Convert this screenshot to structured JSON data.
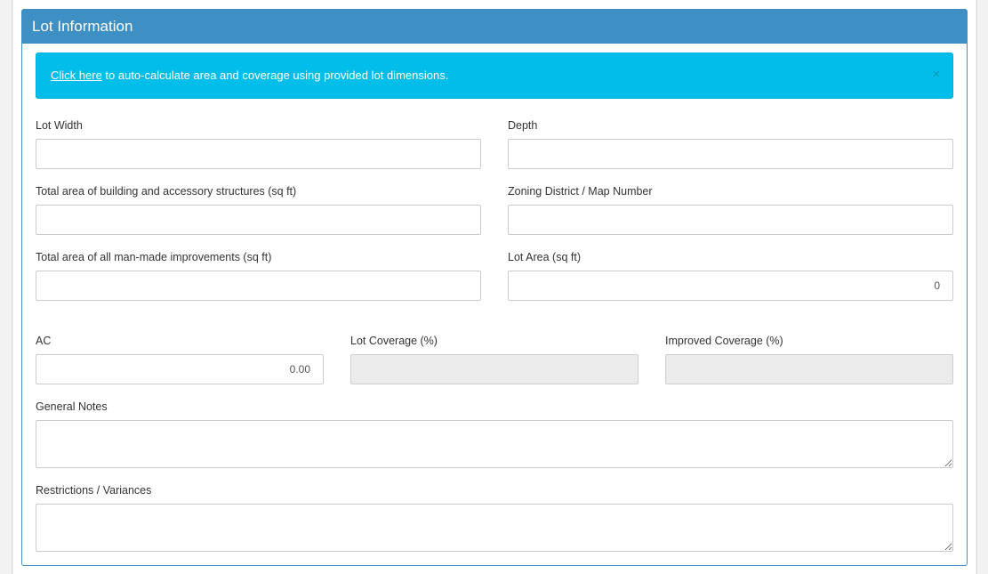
{
  "panel": {
    "title": "Lot Information"
  },
  "alert": {
    "link_text": "Click here",
    "message": " to auto-calculate area and coverage using provided lot dimensions.",
    "close_glyph": "×"
  },
  "fields": {
    "lot_width": {
      "label": "Lot Width",
      "value": ""
    },
    "depth": {
      "label": "Depth",
      "value": ""
    },
    "total_building_area": {
      "label": "Total area of building and accessory structures (sq ft)",
      "value": ""
    },
    "zoning_district": {
      "label": "Zoning District / Map Number",
      "value": ""
    },
    "total_improvements_area": {
      "label": "Total area of all man-made improvements (sq ft)",
      "value": ""
    },
    "lot_area": {
      "label": "Lot Area (sq ft)",
      "value": "0"
    },
    "ac": {
      "label": "AC",
      "value": "0.00"
    },
    "lot_coverage": {
      "label": "Lot Coverage (%)",
      "value": ""
    },
    "improved_coverage": {
      "label": "Improved Coverage (%)",
      "value": ""
    },
    "general_notes": {
      "label": "General Notes",
      "value": ""
    },
    "restrictions": {
      "label": "Restrictions / Variances",
      "value": ""
    }
  }
}
